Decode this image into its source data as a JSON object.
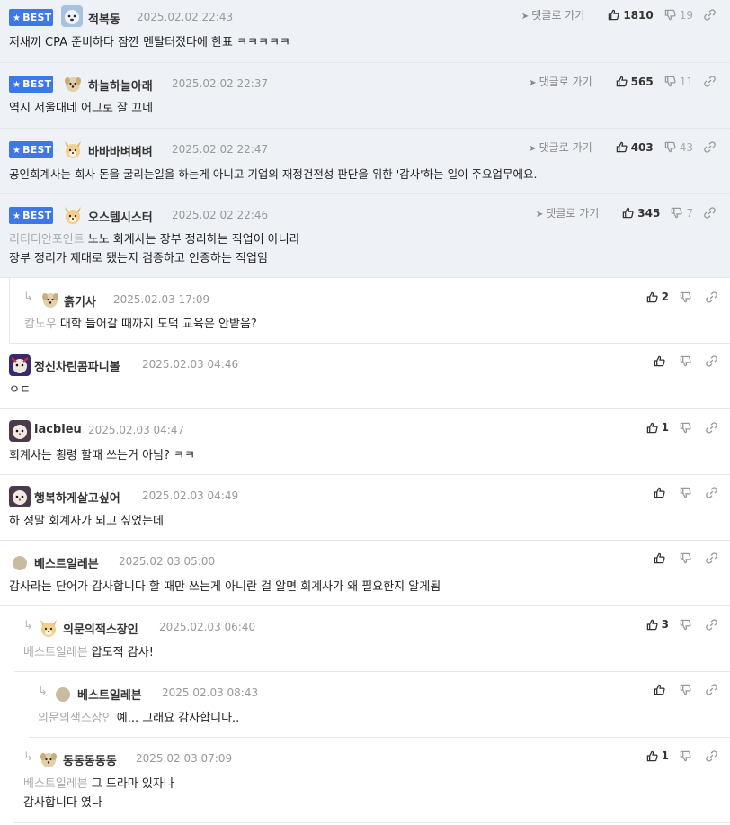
{
  "labels": {
    "best": "BEST",
    "reply": "댓글로 가기"
  },
  "comments": [
    {
      "nick": "적복동",
      "date": "2025.02.02 22:43",
      "up": "1810",
      "down": "19",
      "text": "저새끼 CPA 준비하다 잠깐 멘탈터졌다에 한표 ㅋㅋㅋㅋㅋ"
    },
    {
      "nick": "하늘하늘아래",
      "date": "2025.02.02 22:37",
      "up": "565",
      "down": "11",
      "text": "역시 서울대네 어그로 잘 끄네"
    },
    {
      "nick": "바바바벼벼벼",
      "date": "2025.02.02 22:47",
      "up": "403",
      "down": "43",
      "text": "공인회계사는 회사 돈을 굴리는일을 하는게 아니고 기업의 재정건전성 판단을 위한 '감사'하는 일이 주요업무에요."
    },
    {
      "nick": "오스템시스터",
      "date": "2025.02.02 22:46",
      "up": "345",
      "down": "7",
      "mention": "리티디안포인트",
      "text": "노노 회계사는 장부 정리하는 직업이 아니라",
      "text2": "장부 정리가 제대로 됐는지 검증하고 인증하는 직업임"
    },
    {
      "nick": "흙기사",
      "date": "2025.02.03 17:09",
      "up": "2",
      "mention": "캄노우",
      "text": "대학 들어갈 때까지 도덕 교육은 안받음?"
    },
    {
      "nick": "정신차린콤파니볼",
      "date": "2025.02.03 04:46",
      "up": "",
      "text": "ㅇㄷ"
    },
    {
      "nick": "lacbleu",
      "date": "2025.02.03 04:47",
      "up": "1",
      "text": "회계사는 횡령 할때 쓰는거 아님? ㅋㅋ"
    },
    {
      "nick": "행복하게살고싶어",
      "date": "2025.02.03 04:49",
      "up": "",
      "text": "하 정말 회계사가 되고 싶었는데"
    },
    {
      "nick": "베스트일레븐",
      "date": "2025.02.03 05:00",
      "up": "",
      "text": "감사라는 단어가 감사합니다 할 때만 쓰는게 아니란 걸 알면 회계사가 왜 필요한지 알게됨"
    },
    {
      "nick": "의문의잭스장인",
      "date": "2025.02.03 06:40",
      "up": "3",
      "mention": "베스트일레븐",
      "text": "압도적 감사!"
    },
    {
      "nick": "베스트일레븐",
      "date": "2025.02.03 08:43",
      "up": "",
      "mention": "의문의잭스장인",
      "text": "예... 그래요 감사합니다.."
    },
    {
      "nick": "동동동동동",
      "date": "2025.02.03 07:09",
      "up": "1",
      "mention": "베스트일레븐",
      "text": "그 드라마 있자나",
      "text2": "감사합니다 였나"
    }
  ]
}
